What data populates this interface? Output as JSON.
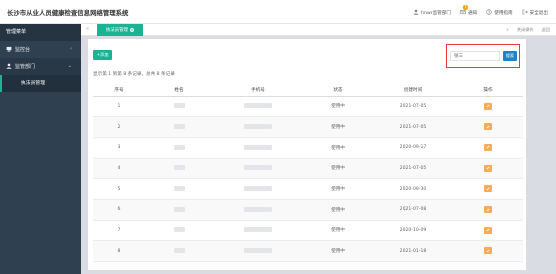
{
  "app": {
    "title": "长沙市从业人员健康检查信息网络管理系统"
  },
  "topbar": {
    "user": "hnwr监管部门",
    "notify_label": "通知",
    "notify_count": "1",
    "help_label": "使用指南",
    "security_label": "安全退出"
  },
  "sidebar": {
    "header": "管理菜单",
    "items": [
      {
        "label": "监控台",
        "arrow": "‹",
        "icon": "monitor-icon"
      },
      {
        "label": "监管部门",
        "arrow": "⌄",
        "icon": "user-icon"
      }
    ],
    "sub_items": [
      {
        "label": "执法员管理"
      }
    ]
  },
  "tabbar": {
    "nav_prev": "«",
    "active_tab": "执法员管理",
    "close": "×",
    "nav_next": "»",
    "actions_label": "关闭操作",
    "back_label": "返回"
  },
  "toolbar": {
    "add_label": "+添加",
    "search_value": "张三",
    "search_btn": "搜索"
  },
  "summary": "显示第 1 到第 8 条记录，总共 8 条记录",
  "table": {
    "headers": [
      "序号",
      "姓名",
      "手机号",
      "状态",
      "创建时间",
      "操作"
    ],
    "rows": [
      {
        "index": "1",
        "status": "使用中",
        "created": "2021-07-05"
      },
      {
        "index": "2",
        "status": "使用中",
        "created": "2021-07-05"
      },
      {
        "index": "3",
        "status": "使用中",
        "created": "2020-09-17"
      },
      {
        "index": "4",
        "status": "使用中",
        "created": "2021-07-05"
      },
      {
        "index": "5",
        "status": "使用中",
        "created": "2020-09-30"
      },
      {
        "index": "6",
        "status": "使用中",
        "created": "2021-07-08"
      },
      {
        "index": "7",
        "status": "使用中",
        "created": "2020-10-09"
      },
      {
        "index": "8",
        "status": "使用中",
        "created": "2021-01-18"
      }
    ]
  },
  "colors": {
    "primary": "#1ab394",
    "search": "#1c84c6",
    "sidebar": "#2f4050",
    "action": "#f8ac59",
    "highlight": "#e63b3b"
  }
}
